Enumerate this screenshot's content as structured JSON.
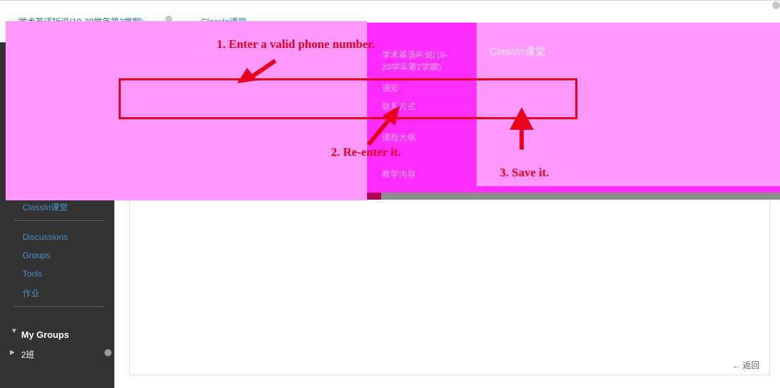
{
  "breadcrumb": {
    "course": "学术英语听说(19-20学年第2学期)",
    "page": "ClassIn课堂"
  },
  "sidebar": {
    "classin_link": "ClassIn课堂",
    "links": [
      "Discussions",
      "Groups",
      "Tools",
      "作业"
    ],
    "my_groups_header": "My Groups",
    "group_item": "2班"
  },
  "content": {
    "back_link": "← 返回"
  },
  "obscured_overlay": {
    "course_title": "学术英语听说(19-20学年第2学期)",
    "menu_items": [
      "通知",
      "联系方式",
      "课程大纲",
      "教学内容"
    ],
    "page_heading": "ClassIn课堂"
  },
  "annotations": {
    "step1": "1. Enter a valid phone number.",
    "step2": "2. Re-enter it.",
    "step3": "3. Save it."
  },
  "colors": {
    "annotation_red": "#e8001c",
    "redaction_light": "#ff99ff",
    "redaction_dark": "#ff2cff",
    "sidebar_bg": "#333333",
    "link_blue": "#2e6f9e"
  },
  "icons": [
    "gear-icon",
    "caret-down-icon",
    "caret-right-icon",
    "plus-circle-icon",
    "arrow-icon"
  ]
}
